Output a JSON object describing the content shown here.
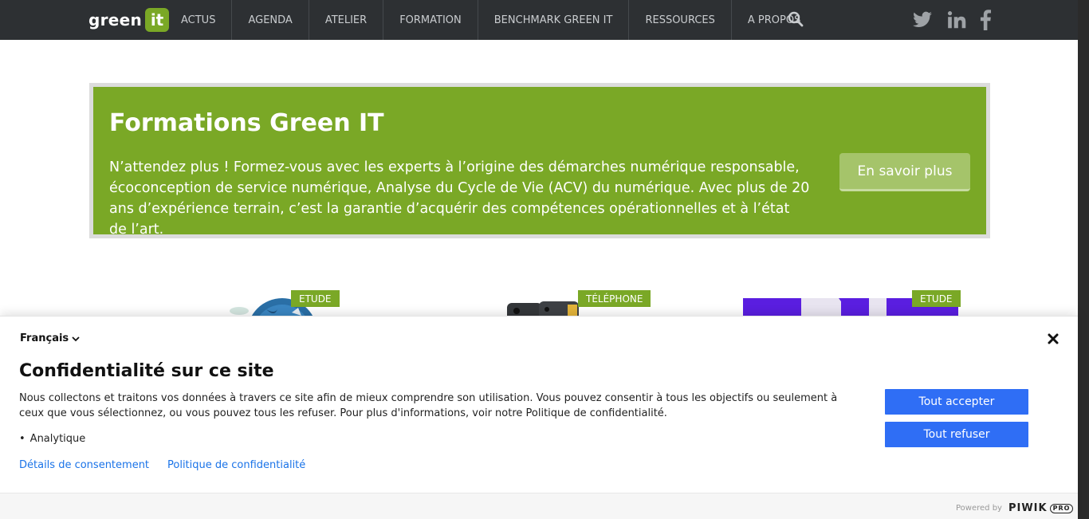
{
  "nav": {
    "logo_text": "green",
    "logo_badge": "it",
    "items": [
      "ACTUS",
      "AGENDA",
      "ATELIER",
      "FORMATION",
      "BENCHMARK GREEN IT",
      "RESSOURCES",
      "A PROPOS"
    ]
  },
  "banner": {
    "title": "Formations Green IT",
    "text": "N’attendez plus ! Formez-vous avec les experts à l’origine des démarches numérique responsable, écoconception de service numérique, Analyse du Cycle de Vie (ACV) du numérique. Avec plus de 20 ans d’expérience terrain, c’est la garantie d’acquérir des compétences opérationnelles et à l’état de l’art.",
    "button": "En savoir plus"
  },
  "cards": [
    {
      "tag": "ETUDE"
    },
    {
      "tag": "TÉLÉPHONE"
    },
    {
      "tag": "ETUDE"
    }
  ],
  "consent": {
    "language": "Français",
    "title": "Confidentialité sur ce site",
    "text": "Nous collectons et traitons vos données à travers ce site afin de mieux comprendre son utilisation. Vous pouvez consentir à tous les objectifs ou seulement à ceux que vous sélectionnez, ou vous pouvez tous les refuser. Pour plus d'informations, voir notre Politique de confidentialité.",
    "bullet": "Analytique",
    "link_details": "Détails de consentement",
    "link_policy": "Politique de confidentialité",
    "accept": "Tout accepter",
    "refuse": "Tout refuser",
    "powered_by": "Powered by",
    "brand": "PIWIK",
    "brand_suffix": "PRO"
  },
  "colors": {
    "nav_bg": "#2d3033",
    "green": "#7aa826",
    "button_blue": "#2f6ef5",
    "link_blue": "#1a73e8"
  }
}
